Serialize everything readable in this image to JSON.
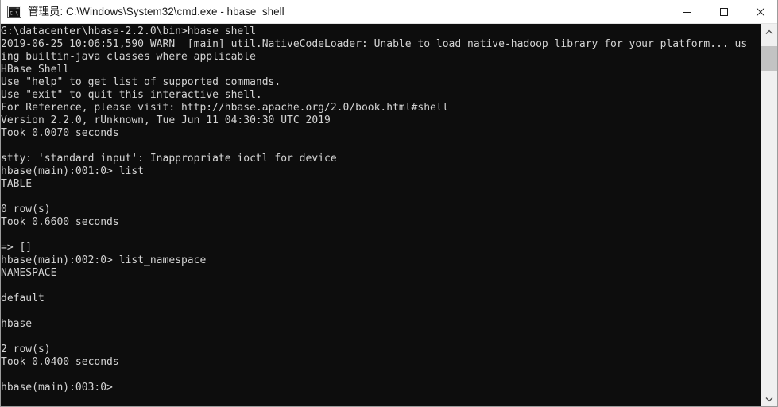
{
  "window": {
    "title": "管理员: C:\\Windows\\System32\\cmd.exe - hbase  shell",
    "icon": "cmd-console-icon",
    "controls": {
      "minimize": "minimize-button",
      "maximize": "maximize-button",
      "close": "close-button"
    },
    "colors": {
      "titlebar_bg": "#ffffff",
      "title_fg": "#1a1a1a",
      "console_bg": "#0d0d0d",
      "console_fg": "#d4d4d4",
      "scrollbar_track": "#f0f0f0",
      "scrollbar_thumb": "#c3c3c3",
      "window_border": "#9b9b9b"
    }
  },
  "scrollbar": {
    "up_arrow": "scroll-up-arrow",
    "down_arrow": "scroll-down-arrow",
    "thumb": "scrollbar-thumb",
    "orientation": "vertical"
  },
  "console": {
    "lines": [
      "G:\\datacenter\\hbase-2.2.0\\bin>hbase shell",
      "2019-06-25 10:06:51,590 WARN  [main] util.NativeCodeLoader: Unable to load native-hadoop library for your platform... us",
      "ing builtin-java classes where applicable",
      "HBase Shell",
      "Use \"help\" to get list of supported commands.",
      "Use \"exit\" to quit this interactive shell.",
      "For Reference, please visit: http://hbase.apache.org/2.0/book.html#shell",
      "Version 2.2.0, rUnknown, Tue Jun 11 04:30:30 UTC 2019",
      "Took 0.0070 seconds",
      "",
      "stty: 'standard input': Inappropriate ioctl for device",
      "hbase(main):001:0> list",
      "TABLE",
      "",
      "0 row(s)",
      "Took 0.6600 seconds",
      "",
      "=> []",
      "hbase(main):002:0> list_namespace",
      "NAMESPACE",
      "",
      "default",
      "",
      "hbase",
      "",
      "2 row(s)",
      "Took 0.0400 seconds",
      "",
      "hbase(main):003:0>"
    ]
  }
}
